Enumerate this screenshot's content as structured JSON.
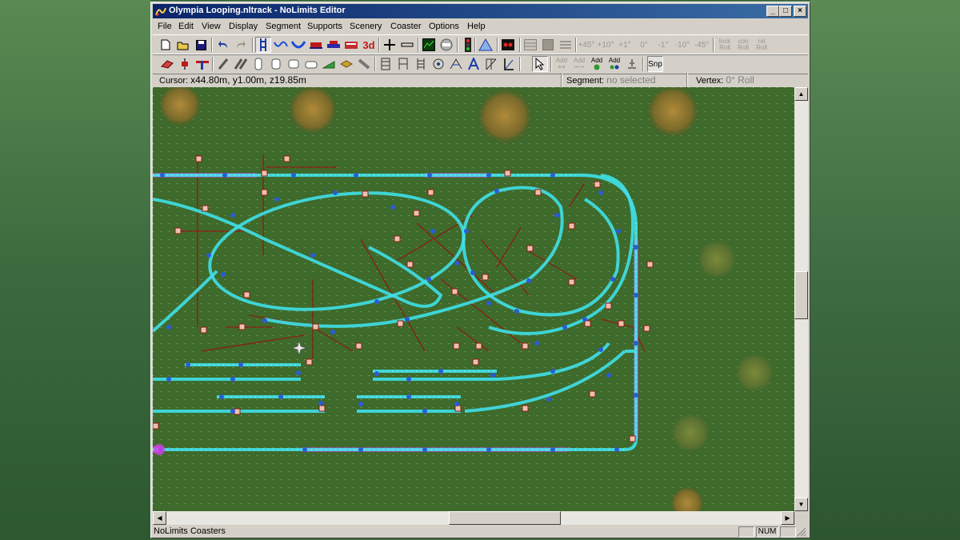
{
  "window": {
    "title": "Olympia Looping.nltrack - NoLimits Editor",
    "controls": {
      "minimize": "_",
      "maximize": "□",
      "close": "×"
    }
  },
  "menu": [
    "File",
    "Edit",
    "View",
    "Display",
    "Segment",
    "Supports",
    "Scenery",
    "Coaster",
    "Options",
    "Help"
  ],
  "toolbar1": {
    "text_buttons": {
      "three_d": "3d"
    },
    "angle_buttons": [
      "+45°",
      "+10°",
      "+1°",
      "0°",
      "-1°",
      "-10°",
      "-45°"
    ],
    "lock_buttons": [
      "lock Roll",
      "con Roll",
      "rel Roll"
    ]
  },
  "toolbar2": {
    "add_buttons": [
      "Add",
      "Add",
      "Add",
      "Add"
    ],
    "snap_label": "Snp"
  },
  "info": {
    "cursor_label": "Cursor:",
    "cursor_value": "x44.80m, y1.00m, z19.85m",
    "segment_label": "Segment:",
    "segment_value": "no selected",
    "vertex_label": "Vertex:",
    "vertex_value": "0° Roll"
  },
  "status": {
    "text": "NoLimits Coasters",
    "num": "NUM"
  },
  "colors": {
    "track": "#3fe0e8",
    "track_selected": "#d040e0",
    "node": "#2a5cd8",
    "support": "#8a1e12",
    "grass": "#3e6a2c",
    "titlebar": "#0a246a"
  }
}
